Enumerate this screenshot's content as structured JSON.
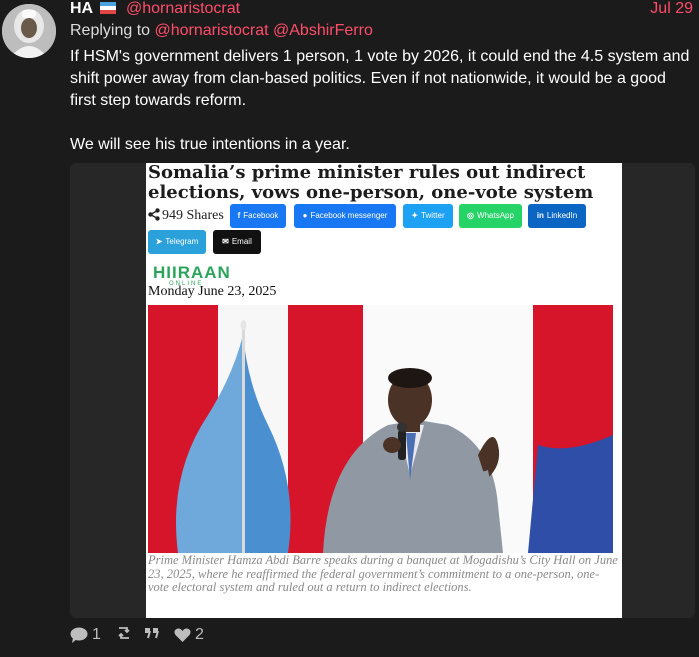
{
  "post": {
    "display_name": "HA",
    "handle": "@hornaristocrat",
    "date": "Jul 29",
    "replying_prefix": "Replying to",
    "replying_to": [
      "@hornaristocrat",
      "@AbshirFerro"
    ],
    "paragraphs": [
      "If HSM's government delivers 1 person, 1 vote by 2026, it could end the 4.5 system and shift power away from clan-based politics. Even if not nationwide, it would be a good first step towards reform.",
      "We will see his true intentions in a year."
    ]
  },
  "article": {
    "headline": "Somalia’s prime minister rules out indirect elections, vows one-person, one-vote system",
    "shares": "949 Shares",
    "share_buttons": [
      {
        "label": "Facebook",
        "icon": "facebook-icon",
        "color": "#1877f2"
      },
      {
        "label": "Facebook messenger",
        "icon": "messenger-icon",
        "color": "#1877f2"
      },
      {
        "label": "Twitter",
        "icon": "twitter-icon",
        "color": "#1da1f2"
      },
      {
        "label": "WhatsApp",
        "icon": "whatsapp-icon",
        "color": "#25d366"
      },
      {
        "label": "LinkedIn",
        "icon": "linkedin-icon",
        "color": "#0a66c2"
      },
      {
        "label": "Telegram",
        "icon": "telegram-icon",
        "color": "#2aa1da"
      },
      {
        "label": "Email",
        "icon": "email-icon",
        "color": "#111111"
      }
    ],
    "logo": "HIIRAAN",
    "logo_sub": "ONLINE",
    "date": "Monday June 23, 2025",
    "caption": "Prime Minister Hamza Abdi Barre speaks during a banquet at Mogadishu’s City Hall on June 23, 2025, where he reaffirmed the federal government’s commitment to a one-person, one-vote electoral system and ruled out a return to indirect elections."
  },
  "actions": {
    "replies": "1",
    "quotes_icon": "quote-icon",
    "likes": "2"
  },
  "colors": {
    "background": "#1b1b1b",
    "accent": "#ff4d6a"
  }
}
